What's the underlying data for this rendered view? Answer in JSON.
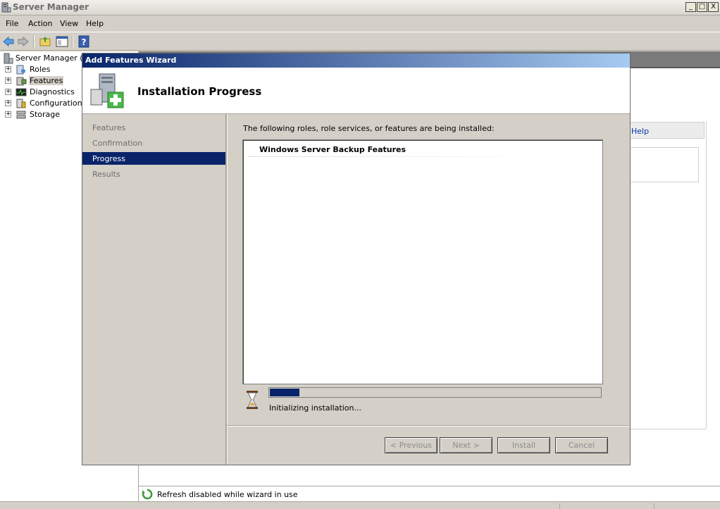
{
  "window": {
    "title": "Server Manager",
    "min": "_",
    "max": "□",
    "close": "X"
  },
  "menu": {
    "file": "File",
    "action": "Action",
    "view": "View",
    "help": "Help"
  },
  "tree": {
    "root": "Server Manager (D",
    "items": [
      {
        "label": "Roles",
        "icon": "roles-icon"
      },
      {
        "label": "Features",
        "icon": "features-icon",
        "selected": true
      },
      {
        "label": "Diagnostics",
        "icon": "diagnostics-icon"
      },
      {
        "label": "Configuration",
        "icon": "configuration-icon"
      },
      {
        "label": "Storage",
        "icon": "storage-icon"
      }
    ],
    "expander": "+"
  },
  "right_pane": {
    "help_link": "Help"
  },
  "status": {
    "text": "Refresh disabled while wizard in use"
  },
  "wizard": {
    "title": "Add Features Wizard",
    "header_title": "Installation Progress",
    "steps": [
      "Features",
      "Confirmation",
      "Progress",
      "Results"
    ],
    "active_step": "Progress",
    "description": "The following roles, role services, or features are being installed:",
    "items": [
      "Windows Server Backup Features"
    ],
    "progress_fraction": 0.09,
    "progress_status": "Initializing installation...",
    "buttons": {
      "previous": "< Previous",
      "next": "Next >",
      "install": "Install",
      "cancel": "Cancel"
    }
  },
  "colors": {
    "selection": "#0a246a",
    "title_gradient_start": "#0a246a",
    "title_gradient_end": "#a6caf0",
    "face": "#d4d0c8"
  }
}
